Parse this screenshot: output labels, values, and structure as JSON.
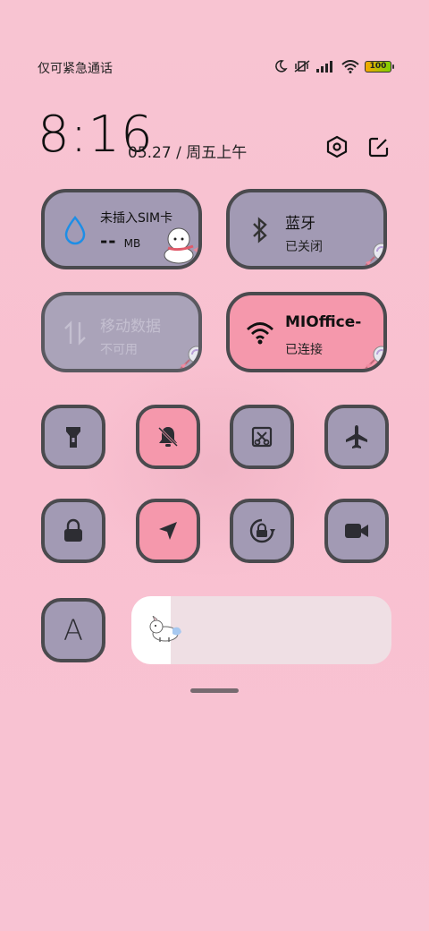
{
  "status_bar": {
    "carrier": "仅可紧急通话",
    "battery": "100",
    "icons": [
      "moon-icon",
      "mute-vibrate-icon",
      "signal-icon",
      "wifi-icon",
      "battery-icon"
    ]
  },
  "header": {
    "time": "8:16",
    "date": "05.27 / 周五上午",
    "icons": [
      "settings-icon",
      "edit-icon"
    ]
  },
  "tiles": [
    {
      "title": "未插入SIM卡",
      "value": "--",
      "unit": "MB",
      "icon": "water-drop-icon",
      "state": "inactive"
    },
    {
      "title": "蓝牙",
      "subtitle": "已关闭",
      "icon": "bluetooth-icon",
      "state": "inactive"
    },
    {
      "title": "移动数据",
      "subtitle": "不可用",
      "icon": "mobile-data-icon",
      "state": "disabled"
    },
    {
      "title": "MIOffice-",
      "subtitle": "已连接",
      "icon": "wifi-icon",
      "state": "active"
    }
  ],
  "toggles": [
    {
      "name": "flashlight",
      "icon": "flashlight-icon",
      "active": false
    },
    {
      "name": "mute",
      "icon": "bell-off-icon",
      "active": true
    },
    {
      "name": "screenshot",
      "icon": "screenshot-icon",
      "active": false
    },
    {
      "name": "airplane",
      "icon": "airplane-icon",
      "active": false
    },
    {
      "name": "lock",
      "icon": "lock-icon",
      "active": false
    },
    {
      "name": "location",
      "icon": "location-arrow-icon",
      "active": true
    },
    {
      "name": "rotation-lock",
      "icon": "rotation-lock-icon",
      "active": false
    },
    {
      "name": "screen-record",
      "icon": "video-camera-icon",
      "active": false
    },
    {
      "name": "font",
      "icon": "font-a-icon",
      "label": "A",
      "active": false
    }
  ],
  "brightness": {
    "level": 0.15
  },
  "colors": {
    "background": "#f9c3d3",
    "tile": "#a29ab4",
    "tile_active": "#f598ac",
    "border": "#4a4a4e"
  }
}
